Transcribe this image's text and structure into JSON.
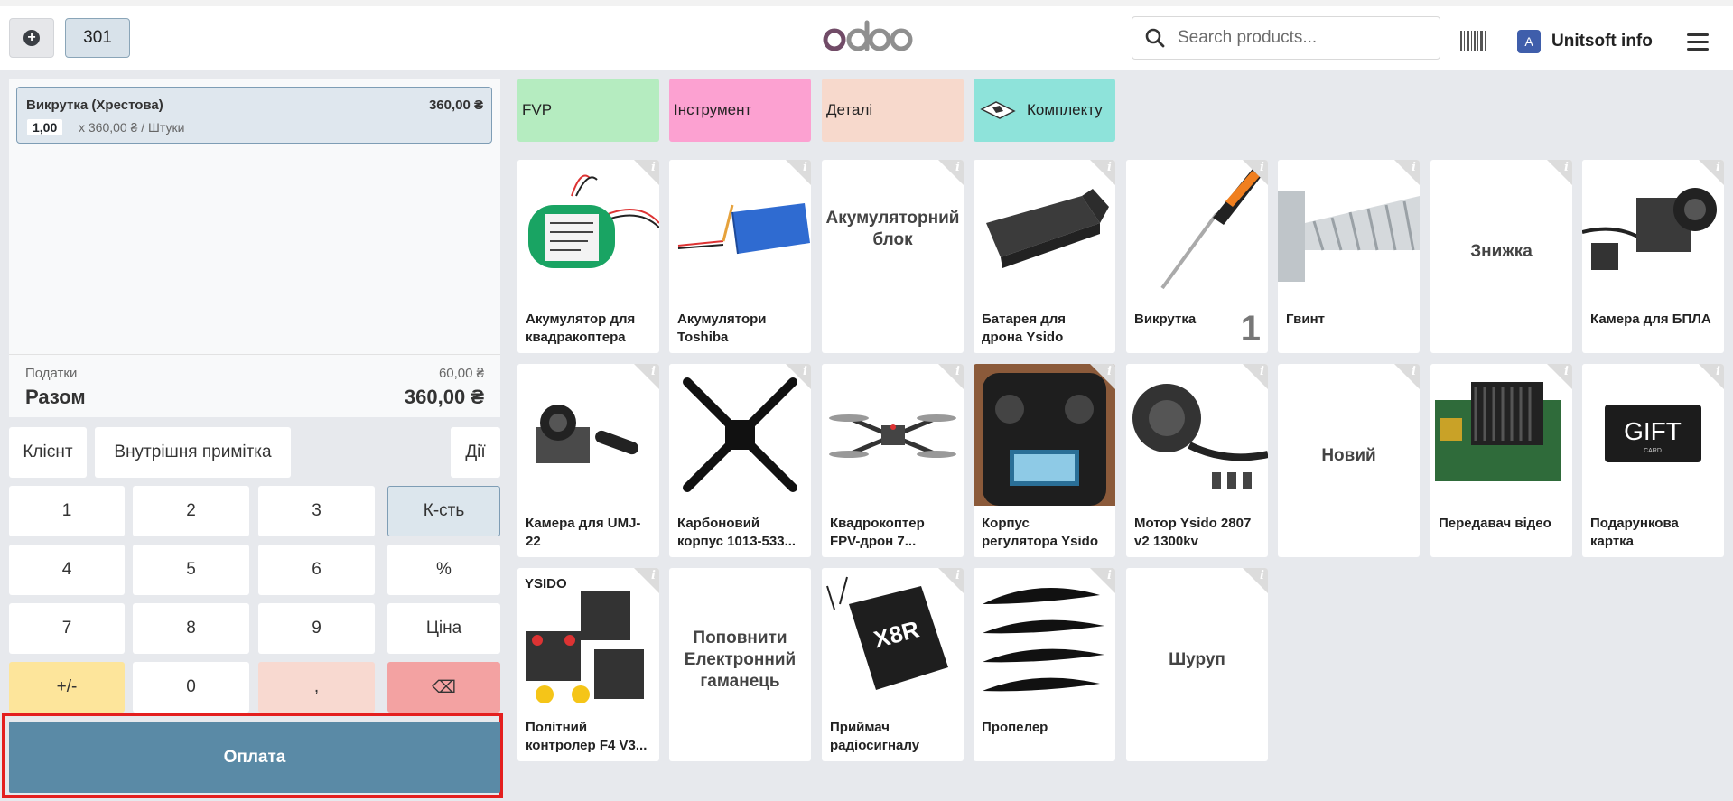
{
  "topbar": {
    "order_number": "301",
    "logo_text": "odoo",
    "search_placeholder": "Search products...",
    "user_initial": "A",
    "user_name": "Unitsoft info"
  },
  "orderlines": [
    {
      "name": "Викрутка (Хрестова)",
      "price": "360,00 ₴",
      "qty": "1,00",
      "unit_price": "x 360,00 ₴ / Штуки"
    }
  ],
  "totals": {
    "tax_label": "Податки",
    "tax_value": "60,00 ₴",
    "total_label": "Разом",
    "total_value": "360,00 ₴"
  },
  "controls": {
    "customer": "Клієнт",
    "internal_note": "Внутрішня примітка",
    "actions": "Дії"
  },
  "numpad": {
    "k1": "1",
    "k2": "2",
    "k3": "3",
    "k4": "4",
    "k5": "5",
    "k6": "6",
    "k7": "7",
    "k8": "8",
    "k9": "9",
    "k0": "0",
    "sign": "+/-",
    "comma": ",",
    "backspace": "⌫",
    "mode_qty": "К-сть",
    "mode_discount": "%",
    "mode_price": "Ціна"
  },
  "payment_label": "Оплата",
  "categories": [
    {
      "label": "FVP",
      "color": "#b5ecc0"
    },
    {
      "label": "Інструмент",
      "color": "#fca1d1"
    },
    {
      "label": "Деталі",
      "color": "#f7d9cc"
    },
    {
      "label": "Комплекту",
      "color": "#8ee3da"
    }
  ],
  "products": [
    {
      "name": "Акумулятор для квадракоптера"
    },
    {
      "name": "Акумулятори Toshiba"
    },
    {
      "name": "Акумуляторний блок"
    },
    {
      "name": "Батарея для дрона Ysido"
    },
    {
      "name": "Викрутка",
      "qty": "1"
    },
    {
      "name": "Гвинт"
    },
    {
      "name": "Знижка"
    },
    {
      "name": "Камера для БПЛА"
    },
    {
      "name": "Камера для UMJ-22"
    },
    {
      "name": "Карбоновий корпус 1013-533..."
    },
    {
      "name": "Квадрокоптер FPV-дрон 7..."
    },
    {
      "name": "Корпус регулятора Ysido"
    },
    {
      "name": "Мотор Ysido 2807 v2 1300kv"
    },
    {
      "name": "Новий"
    },
    {
      "name": "Передавач відео"
    },
    {
      "name": "Подарункова картка",
      "image_text": "GIFT",
      "image_subtext": "CARD"
    },
    {
      "name": "Політний контролер F4 V3...",
      "image_text": "YSIDO"
    },
    {
      "name": "Поповнити Електронний гаманець"
    },
    {
      "name": "Приймач радіосигналу",
      "image_text": "X8R"
    },
    {
      "name": "Пропелер"
    },
    {
      "name": "Шуруп"
    }
  ]
}
